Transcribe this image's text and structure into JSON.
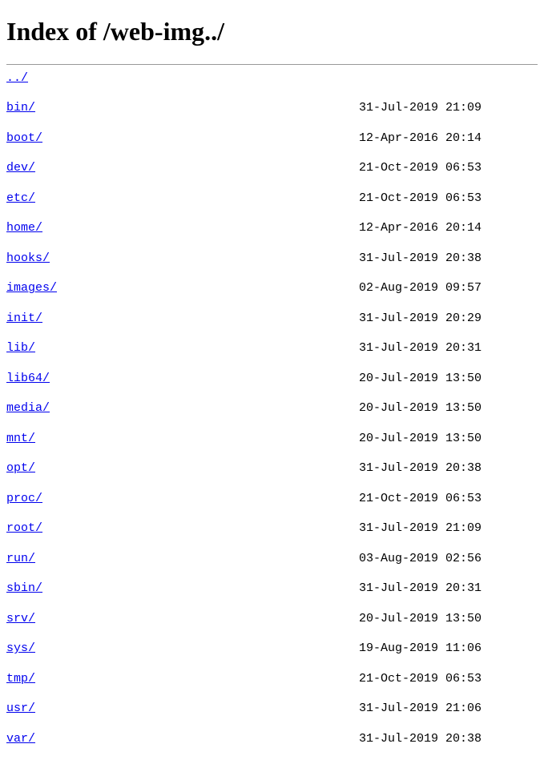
{
  "title": "Index of /web-img../",
  "parent": {
    "name": "../"
  },
  "entries": [
    {
      "name": "bin/",
      "date": "31-Jul-2019 21:09"
    },
    {
      "name": "boot/",
      "date": "12-Apr-2016 20:14"
    },
    {
      "name": "dev/",
      "date": "21-Oct-2019 06:53"
    },
    {
      "name": "etc/",
      "date": "21-Oct-2019 06:53"
    },
    {
      "name": "home/",
      "date": "12-Apr-2016 20:14"
    },
    {
      "name": "hooks/",
      "date": "31-Jul-2019 20:38"
    },
    {
      "name": "images/",
      "date": "02-Aug-2019 09:57"
    },
    {
      "name": "init/",
      "date": "31-Jul-2019 20:29"
    },
    {
      "name": "lib/",
      "date": "31-Jul-2019 20:31"
    },
    {
      "name": "lib64/",
      "date": "20-Jul-2019 13:50"
    },
    {
      "name": "media/",
      "date": "20-Jul-2019 13:50"
    },
    {
      "name": "mnt/",
      "date": "20-Jul-2019 13:50"
    },
    {
      "name": "opt/",
      "date": "31-Jul-2019 20:38"
    },
    {
      "name": "proc/",
      "date": "21-Oct-2019 06:53"
    },
    {
      "name": "root/",
      "date": "31-Jul-2019 21:09"
    },
    {
      "name": "run/",
      "date": "03-Aug-2019 02:56"
    },
    {
      "name": "sbin/",
      "date": "31-Jul-2019 20:31"
    },
    {
      "name": "srv/",
      "date": "20-Jul-2019 13:50"
    },
    {
      "name": "sys/",
      "date": "19-Aug-2019 11:06"
    },
    {
      "name": "tmp/",
      "date": "21-Oct-2019 06:53"
    },
    {
      "name": "usr/",
      "date": "31-Jul-2019 21:06"
    },
    {
      "name": "var/",
      "date": "31-Jul-2019 20:38"
    }
  ]
}
